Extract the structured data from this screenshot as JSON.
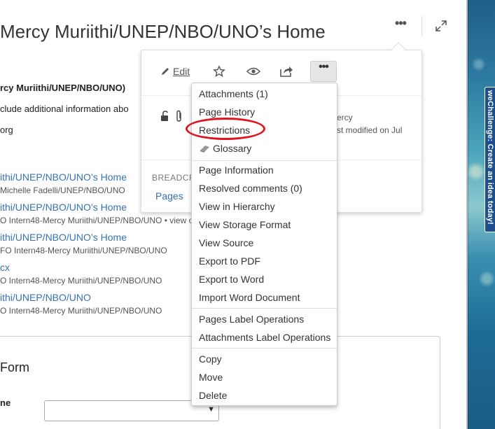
{
  "page": {
    "title": "Mercy Muriithi/UNEP/NBO/UNO’s Home",
    "header_more_icon": "more-horizontal-icon",
    "expand_icon": "expand-icon"
  },
  "profile": {
    "name_line": "rcy Muriithi/UNEP/NBO/UNO)",
    "info_line": "clude additional information abo",
    "domain_line": "org"
  },
  "recent": [
    {
      "title": "ithi/UNEP/NBO/UNO’s Home",
      "meta": "Michelle Fadelli/UNEP/NBO/UNO"
    },
    {
      "title": "ithi/UNEP/NBO/UNO’s Home",
      "meta": "O Intern48-Mercy Muriithi/UNEP/NBO/UNO • view c"
    },
    {
      "title": "ithi/UNEP/NBO/UNO’s Home",
      "meta": "FO Intern48-Mercy Muriithi/UNEP/NBO/UNO"
    },
    {
      "title": "cx",
      "meta": "O Intern48-Mercy Muriithi/UNEP/NBO/UNO"
    },
    {
      "title": "ithi/UNEP/NBO/UNO",
      "meta": "O Intern48-Mercy Muriithi/UNEP/NBO/UNO"
    }
  ],
  "form": {
    "title": "Form",
    "label": "ne",
    "select_value": ""
  },
  "popup": {
    "edit_label": "Edit",
    "meta_line1": "ercy",
    "meta_line2": "st modified on Jul",
    "breadcrumbs_label": "BREADCR",
    "breadcrumb_link": "Pages"
  },
  "menu": {
    "group1": [
      "Attachments (1)",
      "Page History",
      "Restrictions",
      "Glossary"
    ],
    "group2": [
      "Page Information",
      "Resolved comments (0)",
      "View in Hierarchy",
      "View Storage Format",
      "View Source",
      "Export to PDF",
      "Export to Word",
      "Import Word Document"
    ],
    "group3": [
      "Pages Label Operations",
      "Attachments Label Operations"
    ],
    "group4": [
      "Copy",
      "Move",
      "Delete"
    ]
  },
  "side_tab": {
    "label": "weChallenge: Create an idea today!"
  },
  "colors": {
    "link": "#3572b0",
    "highlight": "#e0141e",
    "side_tab": "#1e4e8c"
  }
}
